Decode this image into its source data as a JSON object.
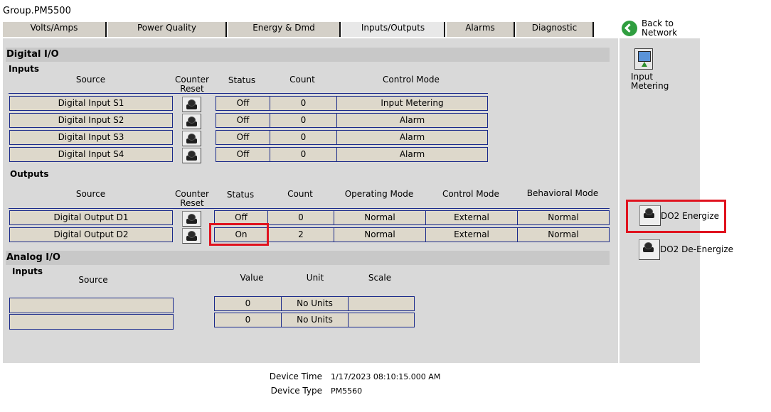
{
  "window_title": "Group.PM5500",
  "tabs": [
    {
      "label": "Volts/Amps"
    },
    {
      "label": "Power Quality"
    },
    {
      "label": "Energy & Dmd"
    },
    {
      "label": "Inputs/Outputs",
      "active": true
    },
    {
      "label": "Alarms"
    },
    {
      "label": "Diagnostic"
    }
  ],
  "back": {
    "line1": "Back to",
    "line2": "Network",
    "icon": "back-arrow-icon"
  },
  "digital_io": {
    "title": "Digital I/O",
    "inputs_label": "Inputs",
    "input_headers": {
      "source": "Source",
      "counter_reset_1": "Counter",
      "counter_reset_2": "Reset",
      "status": "Status",
      "count": "Count",
      "control_mode": "Control Mode"
    },
    "inputs": [
      {
        "source": "Digital Input S1",
        "status": "Off",
        "count": "0",
        "control_mode": "Input Metering"
      },
      {
        "source": "Digital Input S2",
        "status": "Off",
        "count": "0",
        "control_mode": "Alarm"
      },
      {
        "source": "Digital Input S3",
        "status": "Off",
        "count": "0",
        "control_mode": "Alarm"
      },
      {
        "source": "Digital Input S4",
        "status": "Off",
        "count": "0",
        "control_mode": "Alarm"
      }
    ],
    "outputs_label": "Outputs",
    "output_headers": {
      "source": "Source",
      "counter_reset_1": "Counter",
      "counter_reset_2": "Reset",
      "status": "Status",
      "count": "Count",
      "operating_mode": "Operating Mode",
      "control_mode": "Control Mode",
      "behavioral_mode": "Behavioral Mode"
    },
    "outputs": [
      {
        "source": "Digital Output D1",
        "status": "Off",
        "count": "0",
        "operating_mode": "Normal",
        "control_mode": "External",
        "behavioral_mode": "Normal"
      },
      {
        "source": "Digital Output D2",
        "status": "On",
        "count": "2",
        "operating_mode": "Normal",
        "control_mode": "External",
        "behavioral_mode": "Normal"
      }
    ]
  },
  "analog_io": {
    "title": "Analog I/O",
    "inputs_label": "Inputs",
    "headers": {
      "source": "Source",
      "value": "Value",
      "unit": "Unit",
      "scale": "Scale"
    },
    "inputs": [
      {
        "source": "",
        "value": "0",
        "unit": "No Units",
        "scale": ""
      },
      {
        "source": "",
        "value": "0",
        "unit": "No Units",
        "scale": ""
      }
    ]
  },
  "side": {
    "input_metering_1": "Input",
    "input_metering_2": "Metering",
    "do2_energize": "DO2 Energize",
    "do2_deenergize": "DO2 De-Energize"
  },
  "footer": {
    "device_time_label": "Device Time",
    "device_time": "1/17/2023 08:10:15.000 AM",
    "device_type_label": "Device Type",
    "device_type": "PM5560"
  },
  "colors": {
    "highlight": "#e0131f",
    "cell_bg": "#ddd8cb",
    "cell_border": "#1a2a8a"
  }
}
